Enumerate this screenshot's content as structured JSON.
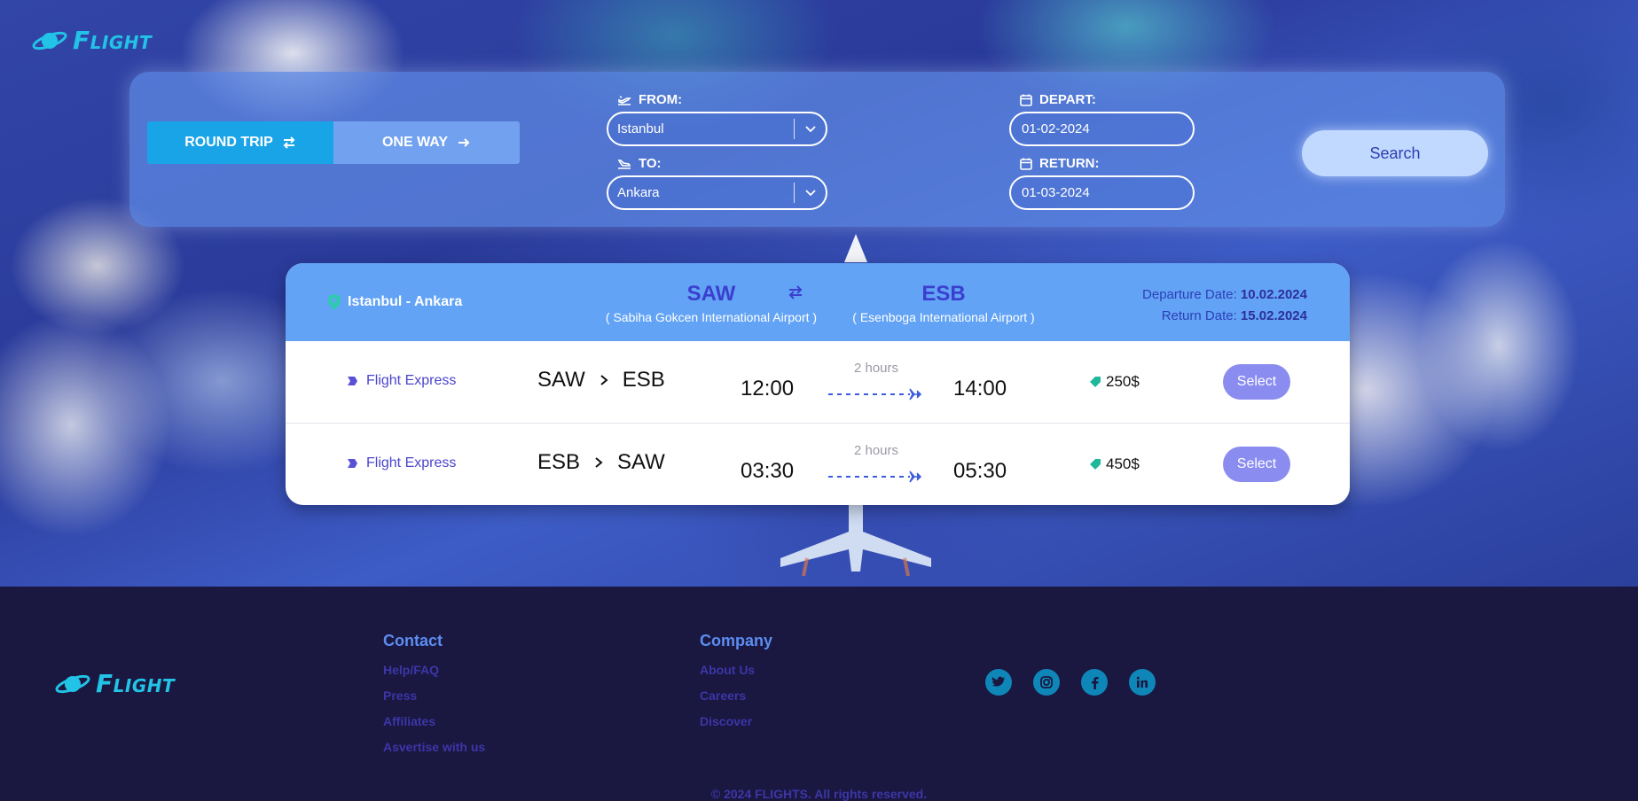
{
  "brand": {
    "name": "Flight"
  },
  "search": {
    "trip_types": [
      {
        "label": "ROUND TRIP",
        "active": true,
        "icon": "swap-arrows-icon"
      },
      {
        "label": "ONE WAY",
        "active": false,
        "icon": "arrow-right-icon"
      }
    ],
    "from_label": "FROM:",
    "from_value": "Istanbul",
    "to_label": "TO:",
    "to_value": "Ankara",
    "depart_label": "DEPART:",
    "depart_value": "01-02-2024",
    "return_label": "RETURN:",
    "return_value": "01-03-2024",
    "search_label": "Search"
  },
  "results": {
    "route_name": "Istanbul - Ankara",
    "origin_code": "SAW",
    "origin_name": "( Sabiha Gokcen International Airport )",
    "destination_code": "ESB",
    "destination_name": "( Esenboga International Airport )",
    "departure_label": "Departure Date:",
    "departure_date": "10.02.2024",
    "return_label": "Return Date:",
    "return_date": "15.02.2024",
    "flights": [
      {
        "airline": "Flight Express",
        "from": "SAW",
        "to": "ESB",
        "depart_time": "12:00",
        "duration": "2 hours",
        "arrive_time": "14:00",
        "price": "250$",
        "select_label": "Select"
      },
      {
        "airline": "Flight Express",
        "from": "ESB",
        "to": "SAW",
        "depart_time": "03:30",
        "duration": "2 hours",
        "arrive_time": "05:30",
        "price": "450$",
        "select_label": "Select"
      }
    ]
  },
  "footer": {
    "contact_title": "Contact",
    "contact_links": [
      "Help/FAQ",
      "Press",
      "Affiliates",
      "Asvertise with us"
    ],
    "company_title": "Company",
    "company_links": [
      "About Us",
      "Careers",
      "Discover"
    ],
    "social": [
      "twitter-icon",
      "instagram-icon",
      "facebook-icon",
      "linkedin-icon"
    ],
    "copyright": "© 2024 FLIGHTS. All rights reserved."
  },
  "colors": {
    "accent": "#1aa4e8",
    "header_blue": "#62a3f5",
    "select_button": "#8a8cf0",
    "footer_bg": "#1a1740",
    "logo": "#22c3e6"
  }
}
